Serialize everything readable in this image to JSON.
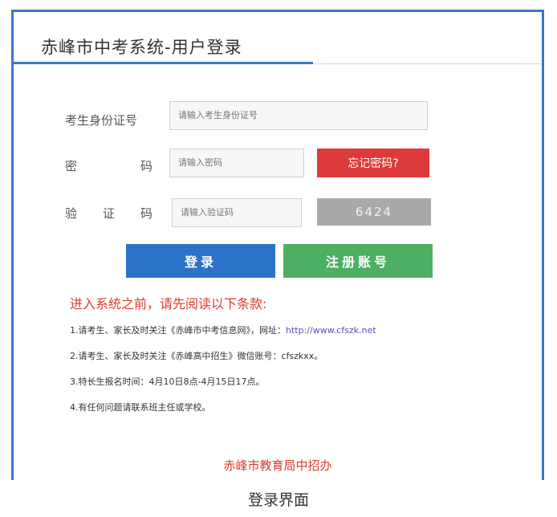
{
  "header": {
    "title": "赤峰市中考系统-用户登录"
  },
  "form": {
    "id_label": "考生身份证号",
    "id_placeholder": "请输入考生身份证号",
    "password_label_1": "密",
    "password_label_2": "码",
    "password_placeholder": "请输入密码",
    "forgot_label": "忘记密码?",
    "captcha_label_1": "验",
    "captcha_label_2": "证",
    "captcha_label_3": "码",
    "captcha_placeholder": "请输入验证码",
    "captcha_code": "6424"
  },
  "actions": {
    "login_label": "登录",
    "register_label": "注册账号"
  },
  "notice": {
    "title": "进入系统之前，请先阅读以下条款:",
    "line1_prefix": "1.请考生、家长及时关注《赤峰市中考信息网》，网址：",
    "line1_link": "http://www.cfszk.net",
    "line2": "2.请考生、家长及时关注《赤峰高中招生》微信账号：cfszkxx。",
    "line3": "3.特长生报名时间：4月10日8点-4月15日17点。",
    "line4": "4.有任何问题请联系班主任或学校。"
  },
  "footer": {
    "org": "赤峰市教育局中招办"
  },
  "caption": "登录界面",
  "colors": {
    "accent": "#3d78c8",
    "danger": "#dd3a3c",
    "login": "#2b72c9",
    "register": "#4caf63",
    "notice": "#e03a2f"
  }
}
